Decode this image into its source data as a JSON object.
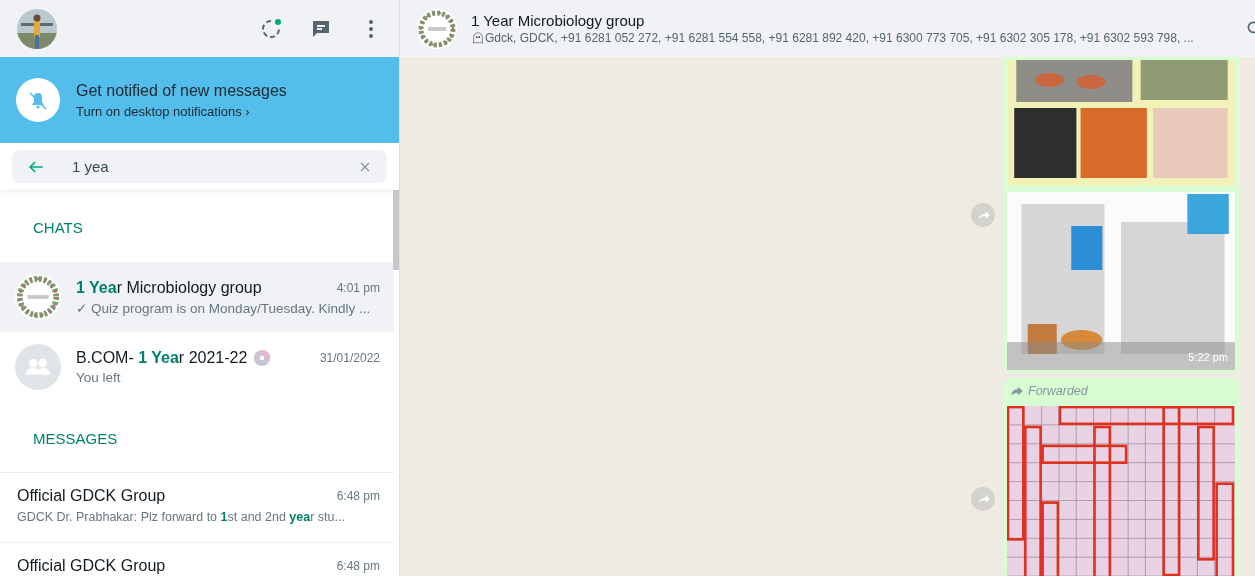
{
  "notification": {
    "title": "Get notified of new messages",
    "subtitle": "Turn on desktop notifications ›"
  },
  "search": {
    "value": "1 yea"
  },
  "sections": [
    {
      "heading": "CHATS",
      "items": [
        {
          "name": "**1 Yea**r Microbiology group",
          "time": "4:01 pm",
          "preview": "✓ Quiz program is on Monday/Tuesday. Kindly ...",
          "kind": "group_picture",
          "disc_emoji": false,
          "selected": true
        },
        {
          "name": "B.COM- **1 Yea**r 2021-22",
          "time": "31/01/2022",
          "preview": "You left",
          "kind": "group_default",
          "disc_emoji": true,
          "selected": false
        }
      ]
    },
    {
      "heading": "MESSAGES",
      "items": [
        {
          "name": "Official GDCK Group",
          "time": "6:48 pm",
          "preview": "GDCK Dr. Prabhakar: Plz forward to **1**st and 2nd **yea**r stu...",
          "kind": "message",
          "disc_emoji": false,
          "selected": false
        },
        {
          "name": "Official GDCK Group",
          "time": "6:48 pm",
          "kind": "message",
          "disc_emoji": false,
          "selected": false
        }
      ]
    }
  ],
  "chat": {
    "title": "1 Year Microbiology group",
    "members": "Gdck, GDCK, +91 6281 052 272, +91 6281 554 558, +91 6281 892 420, +91 6300 773 705, +91 6302 305 178, +91 6302 593 798, ..."
  },
  "messages": [
    {
      "kind": "album",
      "forwarded": false,
      "time": "5:22 pm"
    },
    {
      "kind": "puzzle",
      "forwarded": true,
      "forwarded_label": "Forwarded"
    }
  ]
}
